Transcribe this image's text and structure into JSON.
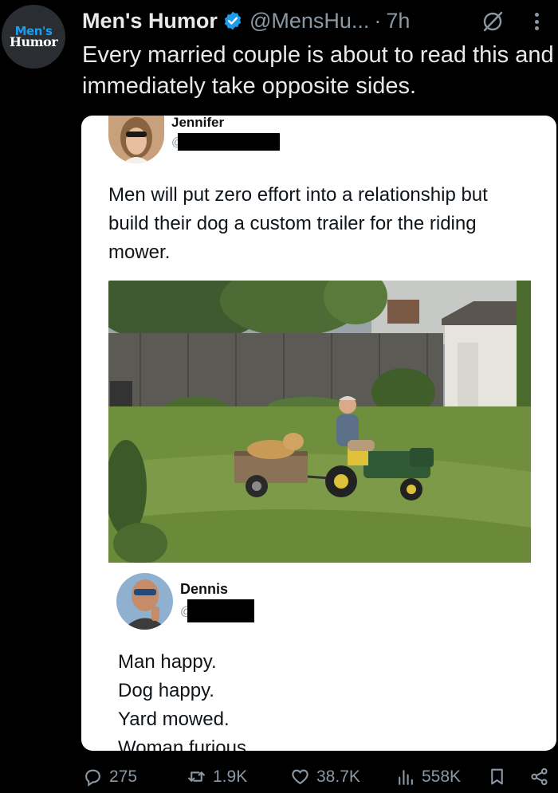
{
  "post": {
    "author_name": "Men's Humor",
    "author_handle": "@MensHu...",
    "separator": "·",
    "time": "7h",
    "avatar_line1": "Men's",
    "avatar_line2": "Humor",
    "text": "Every married couple is about to read this and immediately take opposite sides."
  },
  "embedded": {
    "tweet1": {
      "name": "Jennifer",
      "handle_at": "@",
      "text": "Men will put zero effort into a relationship but build their dog a custom trailer for the riding mower."
    },
    "tweet2": {
      "name": "Dennis",
      "handle_at": "@",
      "lines": [
        "Man happy.",
        "Dog happy.",
        "Yard mowed.",
        "Woman furious"
      ]
    }
  },
  "actions": {
    "replies": "275",
    "reposts": "1.9K",
    "likes": "38.7K",
    "views": "558K"
  },
  "colors": {
    "background": "#000000",
    "verified": "#1d9bf0",
    "muted": "#8b98a5",
    "text": "#e7e9ea"
  }
}
